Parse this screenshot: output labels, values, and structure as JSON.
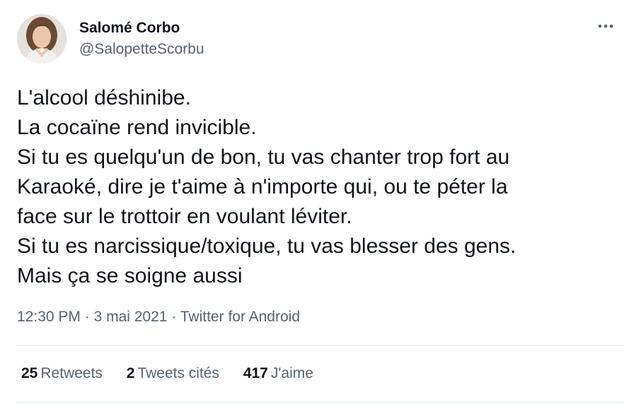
{
  "author": {
    "name": "Salomé Corbo",
    "handle": "@SalopetteScorbu",
    "avatar_icon": "profile-photo"
  },
  "tweet": {
    "lines": [
      "L'alcool déshinibe.",
      "La cocaïne rend invicible.",
      "Si tu es quelqu'un de bon, tu vas chanter trop fort au",
      "Karaoké, dire je t'aime à n'importe qui, ou te péter la",
      "face sur le trottoir en voulant léviter.",
      "Si tu es narcissique/toxique, tu vas blesser des gens.",
      "Mais ça se soigne aussi"
    ]
  },
  "meta": {
    "time": "12:30 PM",
    "separator": " · ",
    "date": "3 mai 2021",
    "source": "Twitter for Android"
  },
  "stats": {
    "retweets": {
      "count": "25",
      "label": "Retweets"
    },
    "quotes": {
      "count": "2",
      "label": "Tweets cités"
    },
    "likes": {
      "count": "417",
      "label": "J'aime"
    }
  },
  "icons": {
    "more": "more-horizontal-icon"
  },
  "colors": {
    "text": "#0f1419",
    "secondary": "#536471",
    "divider": "#e1e8ed"
  }
}
